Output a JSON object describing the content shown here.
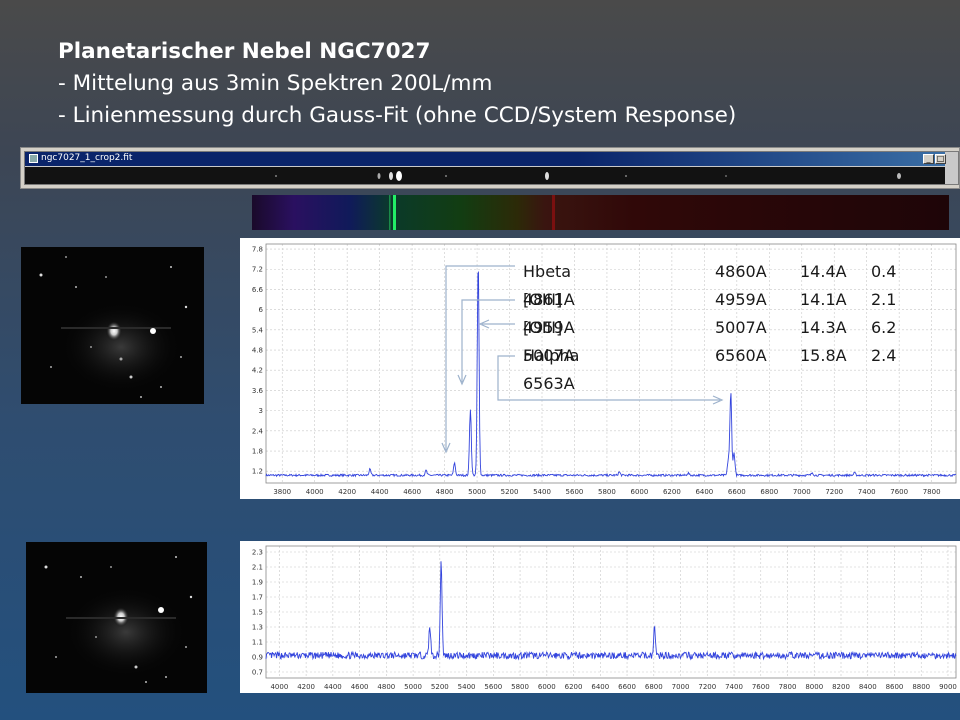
{
  "slide": {
    "title": "Planetarischer Nebel  NGC7027",
    "bullet1": "-  Mittelung aus 3min Spektren 200L/mm",
    "bullet2": "-  Linienmessung durch Gauss-Fit  (ohne CCD/System Response)"
  },
  "window": {
    "title": "ngc7027_1_crop2.fit",
    "buttons": [
      "_",
      "□"
    ]
  },
  "chart_data": [
    {
      "type": "line",
      "name": "top-spectrum",
      "x_ticks": [
        3800,
        4000,
        4200,
        4400,
        4600,
        4800,
        5000,
        5200,
        5400,
        5600,
        5800,
        6000,
        6200,
        6400,
        6600,
        6800,
        7000,
        7200,
        7400,
        7600,
        7800
      ],
      "y_ticks": [
        "1.2",
        "1.8",
        "2.4",
        "3",
        "3.6",
        "4.2",
        "4.8",
        "5.4",
        "6",
        "6.6",
        "7.2",
        "7.8"
      ],
      "xlim": [
        3700,
        7950
      ],
      "ylim": [
        0.85,
        7.95
      ],
      "baseline": 1.08,
      "peaks": [
        {
          "x": 4340,
          "y": 1.25
        },
        {
          "x": 4686,
          "y": 1.22
        },
        {
          "x": 4861,
          "y": 1.45
        },
        {
          "x": 4959,
          "y": 3.05
        },
        {
          "x": 5007,
          "y": 7.45
        },
        {
          "x": 5876,
          "y": 1.18
        },
        {
          "x": 6300,
          "y": 1.15
        },
        {
          "x": 6548,
          "y": 1.55
        },
        {
          "x": 6563,
          "y": 3.55
        },
        {
          "x": 6583,
          "y": 1.75
        },
        {
          "x": 7065,
          "y": 1.16
        },
        {
          "x": 7325,
          "y": 1.15
        }
      ],
      "color": "#3344dd",
      "annotation": {
        "rows": [
          {
            "line": "Hbeta 4861A",
            "measured": "4860A",
            "width": "14.4A",
            "flux": "0.4"
          },
          {
            "line": "[OIII] 4959A",
            "measured": "4959A",
            "width": "14.1A",
            "flux": "2.1"
          },
          {
            "line": "[OIII] 5007A",
            "measured": "5007A",
            "width": "14.3A",
            "flux": "6.2"
          },
          {
            "line": "Halpha 6563A",
            "measured": "6560A",
            "width": "15.8A",
            "flux": "2.4"
          }
        ]
      }
    },
    {
      "type": "line",
      "name": "bottom-spectrum",
      "x_ticks": [
        4000,
        4200,
        4400,
        4600,
        4800,
        5000,
        5200,
        5400,
        5600,
        5800,
        6000,
        6200,
        6400,
        6600,
        6800,
        7000,
        7200,
        7400,
        7600,
        7800,
        8000,
        8200,
        8400,
        8600,
        8800,
        9000
      ],
      "y_ticks": [
        "0.7",
        "0.9",
        "1.1",
        "1.3",
        "1.5",
        "1.7",
        "1.9",
        "2.1",
        "2.3"
      ],
      "xlim": [
        3900,
        9060
      ],
      "ylim": [
        0.62,
        2.38
      ],
      "baseline": 0.92,
      "peaks": [
        {
          "x": 5125,
          "y": 1.32
        },
        {
          "x": 5210,
          "y": 2.2
        },
        {
          "x": 6805,
          "y": 1.3
        }
      ],
      "color": "#3344dd"
    }
  ]
}
